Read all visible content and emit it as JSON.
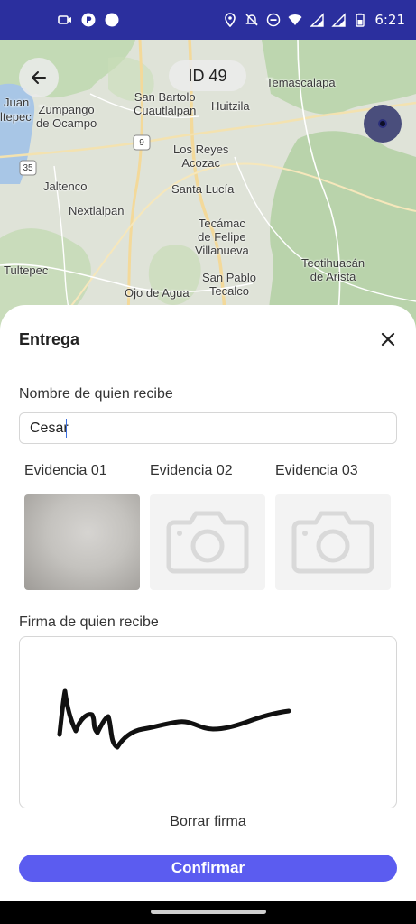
{
  "status_bar": {
    "time": "6:21",
    "left_icons": [
      "video-call-icon",
      "parking-icon",
      "dot-icon"
    ],
    "right_icons": [
      "location-icon",
      "notifications-off-icon",
      "dnd-icon",
      "wifi-icon",
      "signal-icon",
      "signal-2-icon",
      "battery-icon"
    ]
  },
  "map": {
    "labels": [
      {
        "text": "Juan"
      },
      {
        "text": "ltepec"
      },
      {
        "text": "Zumpango\nde Ocampo"
      },
      {
        "text": "San Bartolo\nCuautlalpan"
      },
      {
        "text": "Huitzila"
      },
      {
        "text": "Temascalapa"
      },
      {
        "text": "Los Reyes\nAcozac"
      },
      {
        "text": "Jaltenco"
      },
      {
        "text": "Santa Lucía"
      },
      {
        "text": "Nextlalpan"
      },
      {
        "text": "Tecámac\nde Felipe\nVillanueva"
      },
      {
        "text": "Teotihuacán\nde Arista"
      },
      {
        "text": "Tultepec"
      },
      {
        "text": "San Pablo\nTecalco"
      },
      {
        "text": "Ojo de Agua"
      }
    ],
    "shields": [
      "35",
      "9"
    ],
    "back_icon": "arrow-left-icon",
    "location_icon": "my-location-icon"
  },
  "header": {
    "id_badge": "ID 49"
  },
  "sheet": {
    "title": "Entrega",
    "close_icon": "close-icon",
    "name_label": "Nombre de quien recibe",
    "name_value": "Cesar",
    "evidence": [
      {
        "label": "Evidencia 01",
        "state": "photo"
      },
      {
        "label": "Evidencia 02",
        "state": "empty",
        "icon": "camera-icon"
      },
      {
        "label": "Evidencia 03",
        "state": "empty",
        "icon": "camera-icon"
      }
    ],
    "signature_label": "Firma de quien recibe",
    "clear_signature": "Borrar firma",
    "confirm_label": "Confirmar"
  },
  "colors": {
    "status_bar": "#2b2f9e",
    "accent": "#5b5cf0",
    "location_button": "#4a4e7c"
  }
}
